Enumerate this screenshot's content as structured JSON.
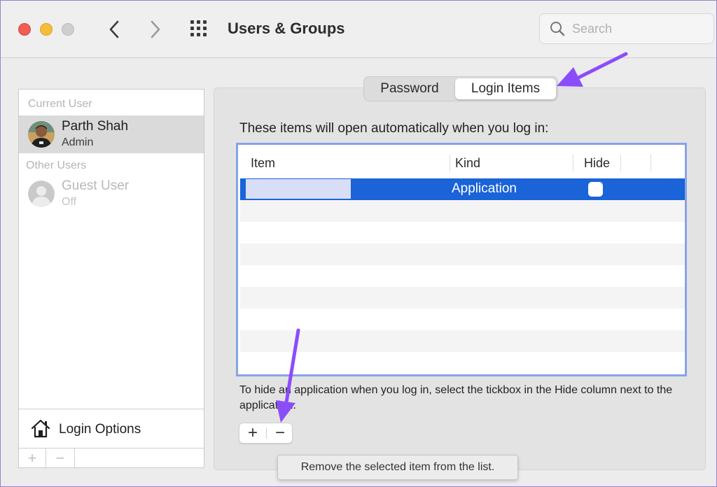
{
  "window": {
    "title": "Users & Groups"
  },
  "search": {
    "placeholder": "Search",
    "value": ""
  },
  "sidebar": {
    "current_user_header": "Current User",
    "current_user": {
      "name": "Parth Shah",
      "role": "Admin"
    },
    "other_users_header": "Other Users",
    "other_users": [
      {
        "name": "Guest User",
        "status": "Off"
      }
    ],
    "login_options_label": "Login Options",
    "add_label": "+",
    "remove_label": "−"
  },
  "tabs": [
    {
      "label": "Password",
      "selected": false
    },
    {
      "label": "Login Items",
      "selected": true
    }
  ],
  "login_items": {
    "intro": "These items will open automatically when you log in:",
    "columns": {
      "item": "Item",
      "kind": "Kind",
      "hide": "Hide"
    },
    "rows": [
      {
        "item": "",
        "kind": "Application",
        "hide": false,
        "selected": true
      }
    ],
    "help_text": "To hide an application when you log in, select the tickbox in the Hide column next to the application.",
    "add_label": "+",
    "remove_label": "−"
  },
  "tooltip": "Remove the selected item from the list.",
  "colors": {
    "accent": "#1a63d8",
    "annotation_arrow": "#8b4dfa",
    "close": "#ee5e55",
    "minimize": "#f5bd3a"
  }
}
